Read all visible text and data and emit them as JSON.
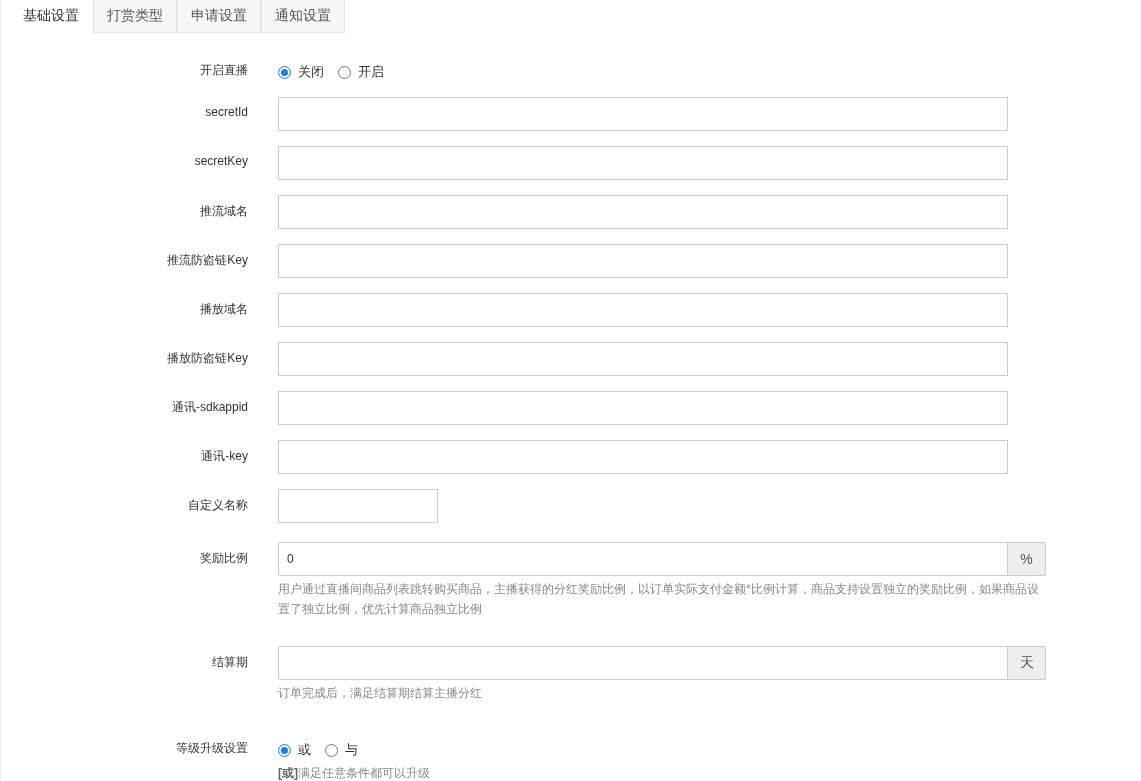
{
  "tabs": [
    {
      "label": "基础设置",
      "selected": true
    },
    {
      "label": "打赏类型",
      "selected": false
    },
    {
      "label": "申请设置",
      "selected": false
    },
    {
      "label": "通知设置",
      "selected": false
    }
  ],
  "fields": [
    {
      "kind": "radio",
      "label": "开启直播",
      "options": [
        {
          "label": "关闭",
          "selected": true
        },
        {
          "label": "开启",
          "selected": false
        }
      ]
    },
    {
      "kind": "text",
      "label": "secretId"
    },
    {
      "kind": "text",
      "label": "secretKey"
    },
    {
      "kind": "text",
      "label": "推流域名"
    },
    {
      "kind": "text",
      "label": "推流防盗链Key"
    },
    {
      "kind": "text",
      "label": "播放域名"
    },
    {
      "kind": "text",
      "label": "播放防盗链Key"
    },
    {
      "kind": "text",
      "label": "通讯-sdkappid"
    },
    {
      "kind": "text",
      "label": "通讯-key"
    },
    {
      "kind": "short",
      "label": "自定义名称"
    },
    {
      "kind": "addon",
      "label": "奖励比例",
      "value": "0",
      "addon": "%",
      "hint": "用户通过直播间商品列表跳转购买商品，主播获得的分红奖励比例，以订单实际支付金额*比例计算，商品支持设置独立的奖励比例，如果商品设置了独立比例，优先计算商品独立比例"
    },
    {
      "kind": "addon",
      "label": "结算期",
      "addon": "天",
      "hint": "订单完成后，满足结算期结算主播分红"
    },
    {
      "kind": "radio",
      "label": "等级升级设置",
      "options": [
        {
          "label": "或",
          "selected": true
        },
        {
          "label": "与",
          "selected": false
        }
      ],
      "hint": "**[或]**满足任意条件都可以升级"
    }
  ]
}
